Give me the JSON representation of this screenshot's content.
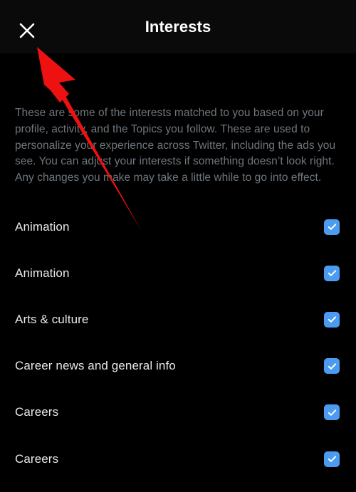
{
  "header": {
    "title": "Interests",
    "close_icon": "close-icon"
  },
  "main": {
    "description": "These are some of the interests matched to you based on your profile, activity, and the Topics you follow. These are used to personalize your experience across Twitter, including the ads you see. You can adjust your interests if something doesn’t look right. Any changes you make may take a little while to go into effect.",
    "interests": [
      {
        "label": "Animation",
        "checked": true
      },
      {
        "label": "Animation",
        "checked": true
      },
      {
        "label": "Arts & culture",
        "checked": true
      },
      {
        "label": "Career news and general info",
        "checked": true
      },
      {
        "label": "Careers",
        "checked": true
      },
      {
        "label": "Careers",
        "checked": true
      }
    ]
  },
  "annotation": {
    "arrow_icon": "red-arrow-annotation",
    "color": "#ee1111"
  },
  "colors": {
    "background": "#000000",
    "header_background": "#0a0a0a",
    "title_text": "#ffffff",
    "description_text": "#6e767d",
    "item_text": "#e7e9ea",
    "checkbox_fill": "#4b9cf0",
    "checkbox_mark": "#ffffff",
    "annotation_red": "#ee1111"
  }
}
